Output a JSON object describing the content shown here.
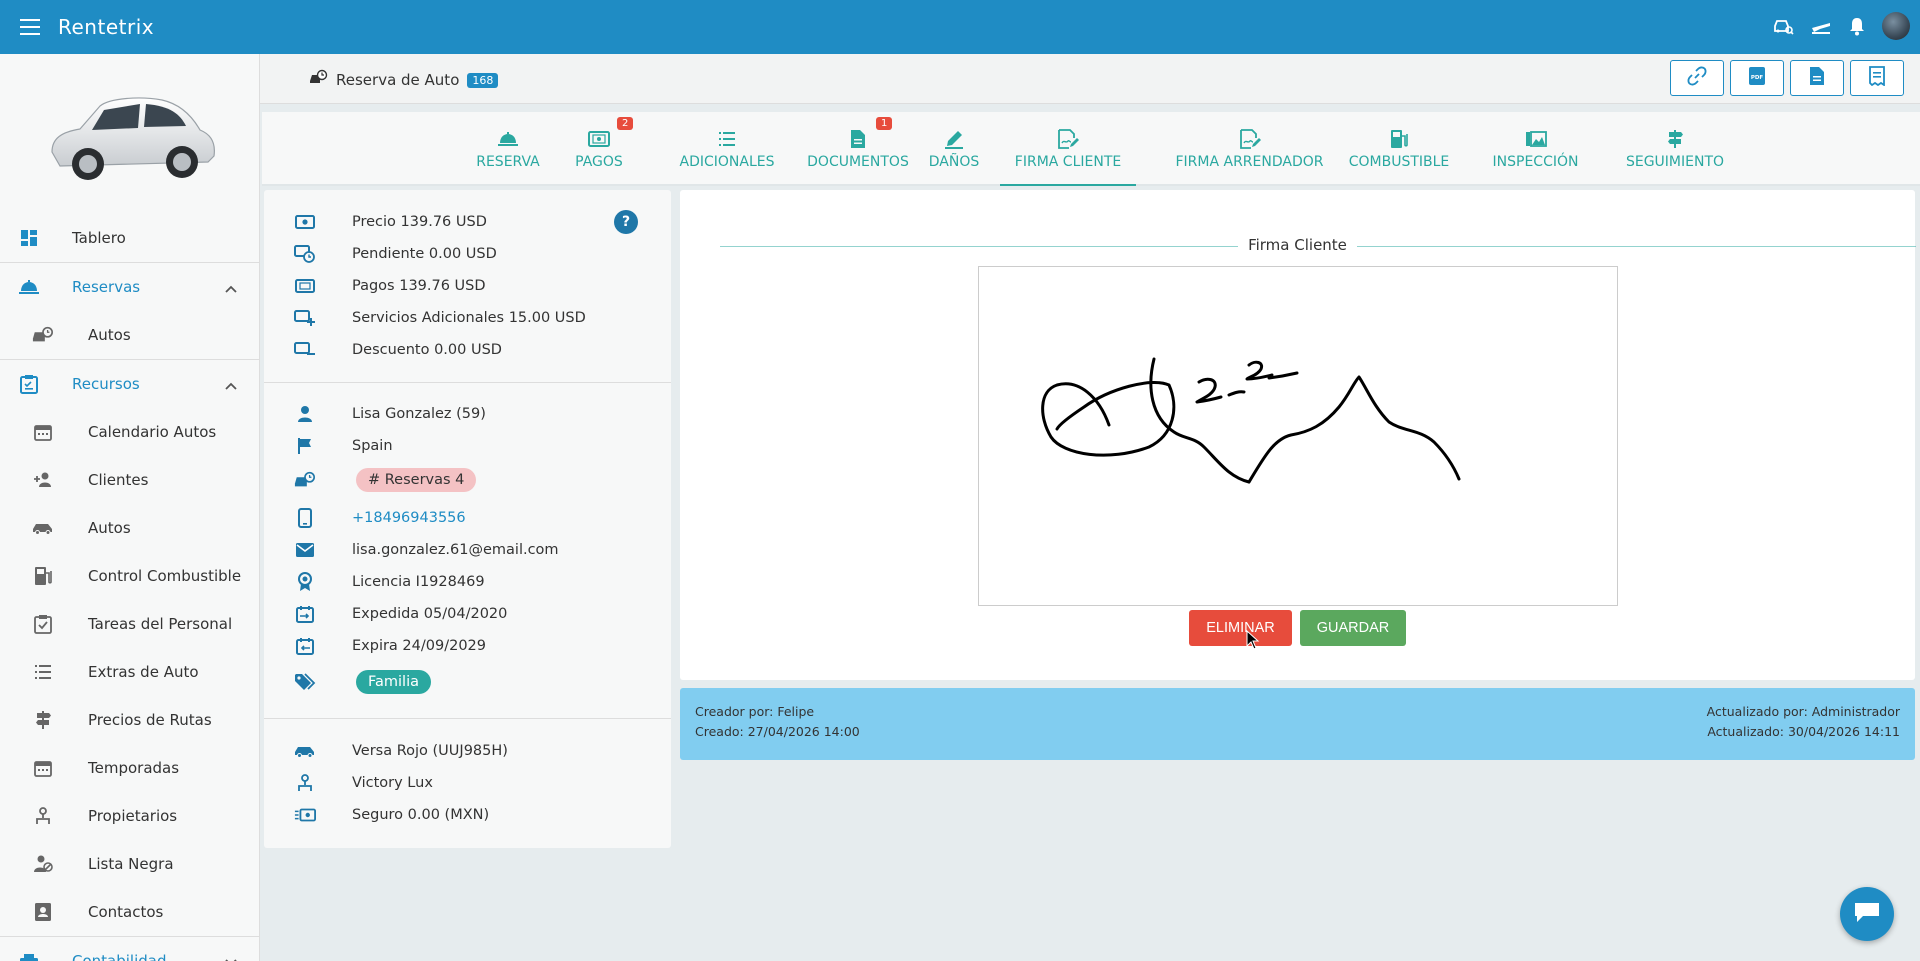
{
  "app": {
    "title": "Rentetrix"
  },
  "colors": {
    "primary": "#1f8cc4",
    "teal": "#2aa8a0",
    "danger": "#e74c3c",
    "success": "#5ba85e",
    "audit_bg": "#81cdf0"
  },
  "header": {
    "title": "Reserva de Auto",
    "badge": "168",
    "actions": [
      "link-icon",
      "pdf-icon",
      "document-icon",
      "receipt-icon"
    ]
  },
  "sidebar": {
    "items": [
      {
        "label": "Tablero",
        "icon": "dashboard-icon"
      },
      {
        "label": "Reservas",
        "icon": "bell-hop-icon",
        "section": true,
        "expanded": true
      },
      {
        "label": "Autos",
        "icon": "car-clock-icon",
        "sub": true
      },
      {
        "label": "Recursos",
        "icon": "clipboard-icon",
        "section": true,
        "expanded": true
      },
      {
        "label": "Calendario Autos",
        "icon": "calendar-icon",
        "sub": true
      },
      {
        "label": "Clientes",
        "icon": "users-icon",
        "sub": true
      },
      {
        "label": "Autos",
        "icon": "car-icon",
        "sub": true
      },
      {
        "label": "Control Combustible",
        "icon": "fuel-icon",
        "sub": true
      },
      {
        "label": "Tareas del Personal",
        "icon": "task-icon",
        "sub": true
      },
      {
        "label": "Extras de Auto",
        "icon": "list-icon",
        "sub": true
      },
      {
        "label": "Precios de Rutas",
        "icon": "signpost-icon",
        "sub": true
      },
      {
        "label": "Temporadas",
        "icon": "calendar-icon",
        "sub": true
      },
      {
        "label": "Propietarios",
        "icon": "owner-icon",
        "sub": true
      },
      {
        "label": "Lista Negra",
        "icon": "blacklist-icon",
        "sub": true
      },
      {
        "label": "Contactos",
        "icon": "contacts-icon",
        "sub": true
      },
      {
        "label": "Contabilidad",
        "icon": "accounting-icon",
        "section": true,
        "expanded": false
      }
    ]
  },
  "tabs": [
    {
      "label": "RESERVA",
      "icon": "bell-hop-icon"
    },
    {
      "label": "PAGOS",
      "icon": "money-icon",
      "badge": "2"
    },
    {
      "label": "ADICIONALES",
      "icon": "list-icon"
    },
    {
      "label": "DOCUMENTOS",
      "icon": "document-icon",
      "badge": "1"
    },
    {
      "label": "DAÑOS",
      "icon": "pen-icon"
    },
    {
      "label": "FIRMA CLIENTE",
      "icon": "signature-icon",
      "active": true
    },
    {
      "label": "FIRMA ARRENDADOR",
      "icon": "signature-icon"
    },
    {
      "label": "COMBUSTIBLE",
      "icon": "fuel-icon"
    },
    {
      "label": "INSPECCIÓN",
      "icon": "inspection-icon"
    },
    {
      "label": "SEGUIMIENTO",
      "icon": "signpost-icon"
    }
  ],
  "reservation": {
    "price": "Precio 139.76 USD",
    "pending": "Pendiente 0.00 USD",
    "payments": "Pagos 139.76 USD",
    "extras": "Servicios Adicionales 15.00 USD",
    "discount": "Descuento 0.00 USD",
    "help": "?"
  },
  "customer": {
    "name": "Lisa Gonzalez (59)",
    "country": "Spain",
    "reservations_chip": "# Reservas 4",
    "phone": "+18496943556",
    "email": "lisa.gonzalez.61@email.com",
    "license": "Licencia I1928469",
    "issued": "Expedida 05/04/2020",
    "expires": "Expira 24/09/2029",
    "tag": "Familia"
  },
  "vehicle": {
    "car": "Versa Rojo (UUJ985H)",
    "owner": "Victory Lux",
    "insurance": "Seguro 0.00 (MXN)"
  },
  "signature": {
    "title": "Firma Cliente",
    "delete_label": "ELIMINAR",
    "save_label": "GUARDAR"
  },
  "audit": {
    "created_by": "Creador por: Felipe",
    "created_at": "Creado: 27/04/2026 14:00",
    "updated_by": "Actualizado por: Administrador",
    "updated_at": "Actualizado: 30/04/2026 14:11"
  }
}
